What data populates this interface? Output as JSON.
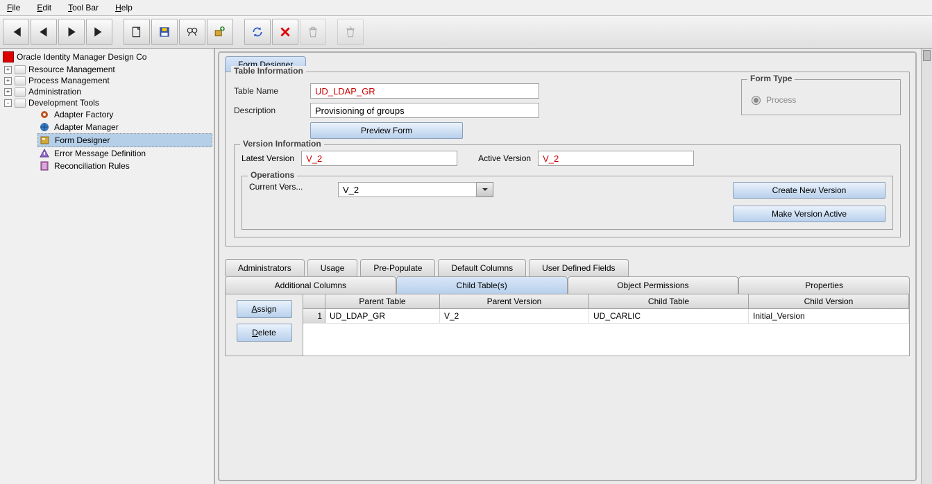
{
  "menu": {
    "file": "File",
    "edit": "Edit",
    "toolbar": "Tool Bar",
    "help": "Help"
  },
  "tree": {
    "root": "Oracle Identity Manager Design Co",
    "items": [
      "Resource Management",
      "Process Management",
      "Administration",
      "Development Tools"
    ],
    "devtools": [
      "Adapter Factory",
      "Adapter Manager",
      "Form Designer",
      "Error Message Definition",
      "Reconciliation Rules"
    ]
  },
  "tab": "Form Designer",
  "tableinfo": {
    "title": "Table Information",
    "tablename_label": "Table Name",
    "tablename": "UD_LDAP_GR",
    "description_label": "Description",
    "description": "Provisioning of groups",
    "preview": "Preview Form"
  },
  "formtype": {
    "title": "Form Type",
    "process": "Process"
  },
  "version": {
    "title": "Version Information",
    "latest_label": "Latest Version",
    "latest": "V_2",
    "active_label": "Active Version",
    "active": "V_2"
  },
  "ops": {
    "title": "Operations",
    "current_label": "Current Vers...",
    "current": "V_2",
    "createnew": "Create New Version",
    "makeactive": "Make Version Active"
  },
  "tabs1": [
    "Administrators",
    "Usage",
    "Pre-Populate",
    "Default Columns",
    "User Defined Fields"
  ],
  "tabs2": [
    "Additional Columns",
    "Child Table(s)",
    "Object Permissions",
    "Properties"
  ],
  "sidebtn": {
    "assign": "Assign",
    "delete": "Delete"
  },
  "grid": {
    "headers": [
      "Parent Table",
      "Parent Version",
      "Child Table",
      "Child Version"
    ],
    "row": {
      "n": "1",
      "parent_table": "UD_LDAP_GR",
      "parent_version": "V_2",
      "child_table": "UD_CARLIC",
      "child_version": "Initial_Version"
    }
  }
}
